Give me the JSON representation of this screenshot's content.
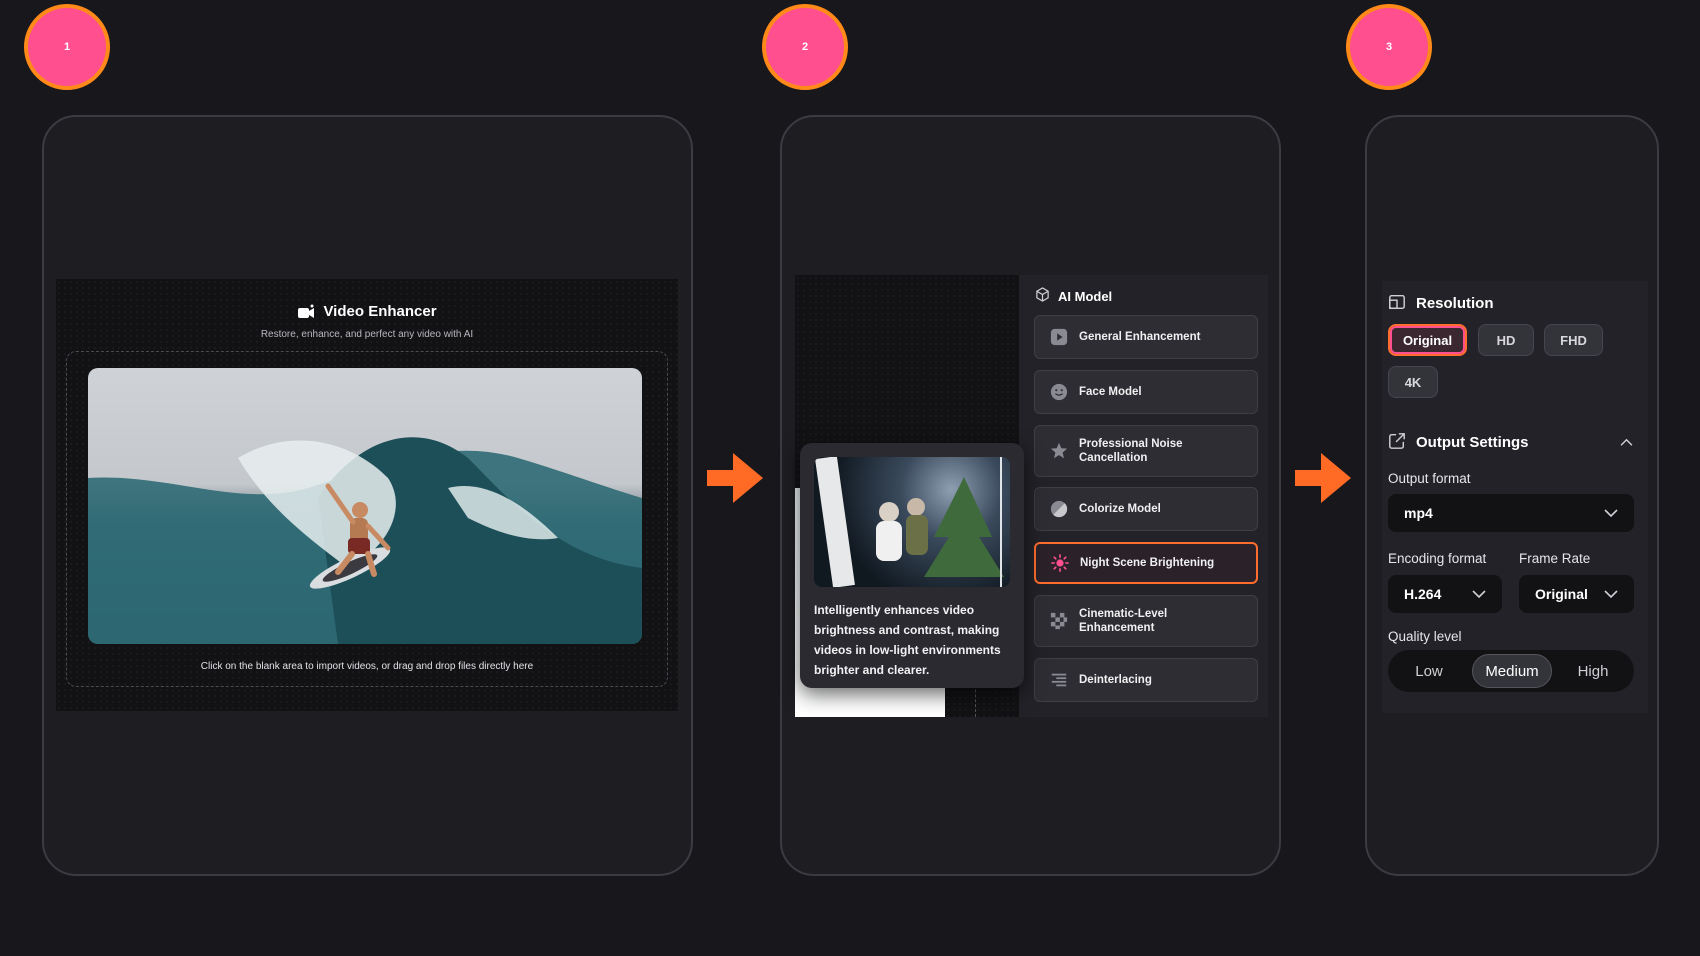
{
  "steps": [
    "1",
    "2",
    "3"
  ],
  "panel1": {
    "title": "Video Enhancer",
    "subtitle": "Restore, enhance, and perfect any video with AI",
    "drop_hint": "Click on the blank area to import videos, or drag and drop files directly here"
  },
  "panel2": {
    "section_title": "AI Model",
    "models": [
      {
        "label": "General Enhancement",
        "icon": "play-square-icon"
      },
      {
        "label": "Face Model",
        "icon": "smile-face-icon"
      },
      {
        "label": "Professional Noise Cancellation",
        "icon": "star-icon"
      },
      {
        "label": "Colorize Model",
        "icon": "color-circle-icon"
      },
      {
        "label": "Night Scene Brightening",
        "icon": "sun-icon",
        "active": true
      },
      {
        "label": "Cinematic-Level Enhancement",
        "icon": "checker-icon"
      },
      {
        "label": "Deinterlacing",
        "icon": "lines-icon"
      }
    ],
    "tooltip": "Intelligently enhances video brightness and contrast, making videos in low-light environments brighter and clearer."
  },
  "panel3": {
    "resolution_title": "Resolution",
    "resolutions": [
      "Original",
      "HD",
      "FHD",
      "4K"
    ],
    "selected_resolution": "Original",
    "output_title": "Output Settings",
    "output_format_label": "Output format",
    "output_format_value": "mp4",
    "encoding_label": "Encoding format",
    "encoding_value": "H.264",
    "frame_rate_label": "Frame Rate",
    "frame_rate_value": "Original",
    "quality_label": "Quality level",
    "quality_options": [
      "Low",
      "Medium",
      "High"
    ],
    "quality_selected": "Medium"
  },
  "colors": {
    "background": "#17171c",
    "badge_fill": "#ff4f8f",
    "badge_ring": "#ff8a1a",
    "arrow": "#ff6a24",
    "accent_border": "#ff6d2e"
  }
}
